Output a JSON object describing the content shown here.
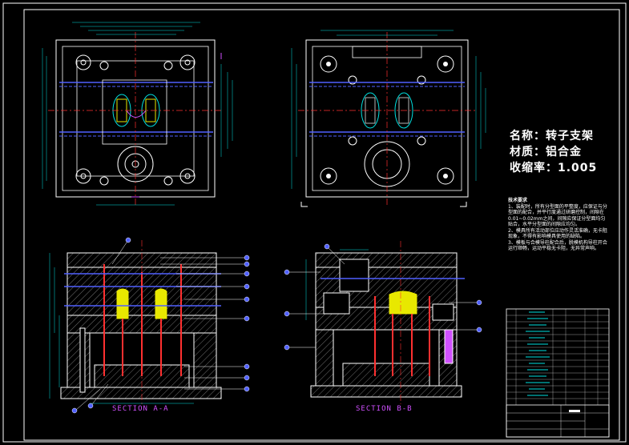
{
  "title_block": {
    "name_label": "名称：",
    "name_value": "转子支架",
    "material_label": "材质：",
    "material_value": "铝合金",
    "shrink_label": "收缩率：",
    "shrink_value": "1.005"
  },
  "notes": {
    "heading": "技术要求",
    "lines": [
      "1、装配时，所有分型面的平整度，应保证与分型面的配合，并平行度通过研磨控制，间隙在0.01~0.02mm之间，间隙应保证分型面均匀贴合，水平分型面的间隙应均匀。",
      "2、模具所有活动部位应动作灵活准确，无卡阻现象，不得有影响模具使用的缺陷。",
      "3、模板与合模导柱配合后，脱模机构导柱开合运行顺畅，运动平稳无卡阻，无异常声响。"
    ]
  },
  "sections": {
    "a": "SECTION A-A",
    "b": "SECTION B-B"
  },
  "colors": {
    "background": "#000000",
    "outline": "#ffffff",
    "center_line": "#ff3030",
    "dimension": "#00e0e0",
    "bolt": "#5060ff",
    "insert": "#e8e800",
    "section_label": "#d050ff",
    "hatch": "#ffffff"
  },
  "icons": {
    "balloon": "blue-circle-balloon"
  }
}
